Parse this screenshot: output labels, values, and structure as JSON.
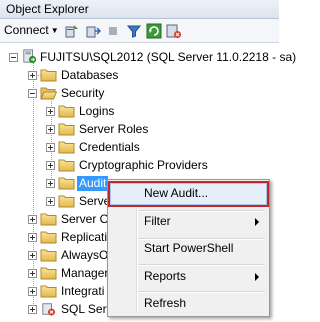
{
  "panel": {
    "title": "Object Explorer"
  },
  "toolbar": {
    "connect_label": "Connect"
  },
  "tree": {
    "server": "FUJITSU\\SQL2012 (SQL Server 11.0.2218 - sa)",
    "databases": "Databases",
    "security": "Security",
    "logins": "Logins",
    "server_roles": "Server Roles",
    "credentials": "Credentials",
    "crypto_providers": "Cryptographic Providers",
    "audits": "Audit",
    "server_audit_specs": "Serve",
    "server_objects": "Server Ol",
    "replication": "Replicati",
    "alwayson": "AlwaysO",
    "management": "Manager",
    "integration": "Integrati",
    "sql_agent": "SQL Serv"
  },
  "context_menu": {
    "new_audit": "New Audit...",
    "filter": "Filter",
    "start_powershell": "Start PowerShell",
    "reports": "Reports",
    "refresh": "Refresh"
  },
  "colors": {
    "selection": "#3399ff",
    "highlight_border": "#c0272d"
  }
}
